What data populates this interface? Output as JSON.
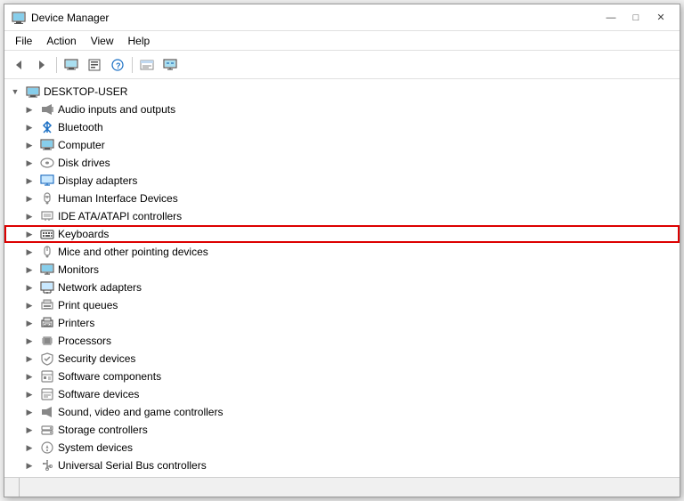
{
  "window": {
    "title": "Device Manager",
    "icon": "🖥",
    "title_buttons": {
      "minimize": "—",
      "maximize": "□",
      "close": "✕"
    }
  },
  "menubar": {
    "items": [
      "File",
      "Action",
      "View",
      "Help"
    ]
  },
  "toolbar": {
    "buttons": [
      {
        "name": "back",
        "icon": "◀",
        "label": "Back"
      },
      {
        "name": "forward",
        "icon": "▶",
        "label": "Forward"
      },
      {
        "name": "computer",
        "icon": "🖥",
        "label": "Computer"
      },
      {
        "name": "properties",
        "icon": "📋",
        "label": "Properties"
      },
      {
        "name": "help",
        "icon": "?",
        "label": "Help"
      },
      {
        "name": "update",
        "icon": "📂",
        "label": "Update"
      },
      {
        "name": "monitor",
        "icon": "🖥",
        "label": "Monitor"
      }
    ]
  },
  "tree": {
    "root": {
      "label": "DESKTOP-USER",
      "icon": "💻"
    },
    "items": [
      {
        "id": "audio",
        "label": "Audio inputs and outputs",
        "icon": "🔊",
        "indent": 1,
        "expanded": false
      },
      {
        "id": "bluetooth",
        "label": "Bluetooth",
        "icon": "📡",
        "indent": 1,
        "expanded": false
      },
      {
        "id": "computer",
        "label": "Computer",
        "icon": "💻",
        "indent": 1,
        "expanded": false
      },
      {
        "id": "disk",
        "label": "Disk drives",
        "icon": "💿",
        "indent": 1,
        "expanded": false
      },
      {
        "id": "display",
        "label": "Display adapters",
        "icon": "🖥",
        "indent": 1,
        "expanded": false
      },
      {
        "id": "hid",
        "label": "Human Interface Devices",
        "icon": "🎮",
        "indent": 1,
        "expanded": false
      },
      {
        "id": "ide",
        "label": "IDE ATA/ATAPI controllers",
        "icon": "💾",
        "indent": 1,
        "expanded": false
      },
      {
        "id": "keyboards",
        "label": "Keyboards",
        "icon": "⌨",
        "indent": 1,
        "expanded": false,
        "highlighted": true
      },
      {
        "id": "mice",
        "label": "Mice and other pointing devices",
        "icon": "🖱",
        "indent": 1,
        "expanded": false
      },
      {
        "id": "monitors",
        "label": "Monitors",
        "icon": "🖥",
        "indent": 1,
        "expanded": false
      },
      {
        "id": "network",
        "label": "Network adapters",
        "icon": "🌐",
        "indent": 1,
        "expanded": false
      },
      {
        "id": "printqueue",
        "label": "Print queues",
        "icon": "🖨",
        "indent": 1,
        "expanded": false
      },
      {
        "id": "printers",
        "label": "Printers",
        "icon": "🖨",
        "indent": 1,
        "expanded": false
      },
      {
        "id": "processors",
        "label": "Processors",
        "icon": "⚙",
        "indent": 1,
        "expanded": false
      },
      {
        "id": "security",
        "label": "Security devices",
        "icon": "🔒",
        "indent": 1,
        "expanded": false
      },
      {
        "id": "swcomponents",
        "label": "Software components",
        "icon": "📦",
        "indent": 1,
        "expanded": false
      },
      {
        "id": "swdevices",
        "label": "Software devices",
        "icon": "📦",
        "indent": 1,
        "expanded": false
      },
      {
        "id": "soundvideo",
        "label": "Sound, video and game controllers",
        "icon": "🎵",
        "indent": 1,
        "expanded": false
      },
      {
        "id": "storage",
        "label": "Storage controllers",
        "icon": "💾",
        "indent": 1,
        "expanded": false
      },
      {
        "id": "system",
        "label": "System devices",
        "icon": "⚙",
        "indent": 1,
        "expanded": false
      },
      {
        "id": "usb",
        "label": "Universal Serial Bus controllers",
        "icon": "🔌",
        "indent": 1,
        "expanded": false
      }
    ]
  },
  "statusbar": {
    "segments": [
      "",
      "",
      ""
    ]
  },
  "colors": {
    "highlight_border": "#cc0000",
    "selection_bg": "#cce8ff",
    "toolbar_bg": "#ffffff"
  }
}
